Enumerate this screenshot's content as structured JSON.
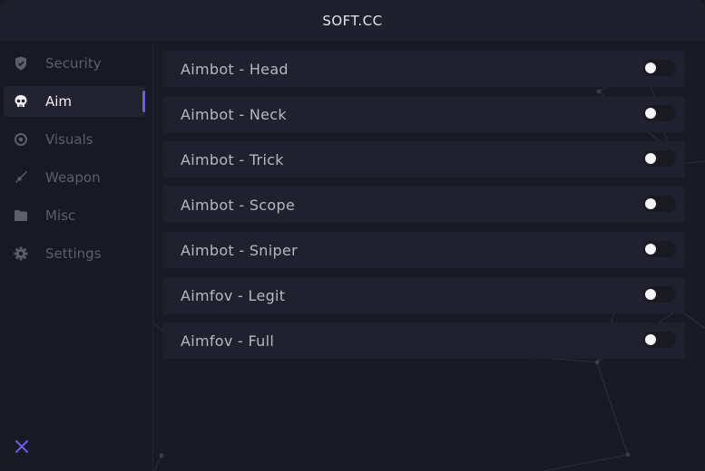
{
  "window": {
    "title": "SOFT.CC"
  },
  "sidebar": {
    "items": [
      {
        "label": "Security",
        "icon": "shield-icon",
        "active": false
      },
      {
        "label": "Aim",
        "icon": "skull-icon",
        "active": true
      },
      {
        "label": "Visuals",
        "icon": "target-icon",
        "active": false
      },
      {
        "label": "Weapon",
        "icon": "weapon-icon",
        "active": false
      },
      {
        "label": "Misc",
        "icon": "folder-icon",
        "active": false
      },
      {
        "label": "Settings",
        "icon": "gear-icon",
        "active": false
      }
    ],
    "close_icon": "close-icon"
  },
  "colors": {
    "accent": "#6c5ce7",
    "background": "#1a1a25",
    "row_background": "#20202e",
    "text_active": "#f2f2f7",
    "text_inactive": "#5d5d6b"
  },
  "aim": {
    "options": [
      {
        "label": "Aimbot - Head",
        "enabled": false
      },
      {
        "label": "Aimbot - Neck",
        "enabled": false
      },
      {
        "label": "Aimbot - Trick",
        "enabled": false
      },
      {
        "label": "Aimbot - Scope",
        "enabled": false
      },
      {
        "label": "Aimbot - Sniper",
        "enabled": false
      },
      {
        "label": "Aimfov - Legit",
        "enabled": false
      },
      {
        "label": "Aimfov - Full",
        "enabled": false
      }
    ]
  }
}
